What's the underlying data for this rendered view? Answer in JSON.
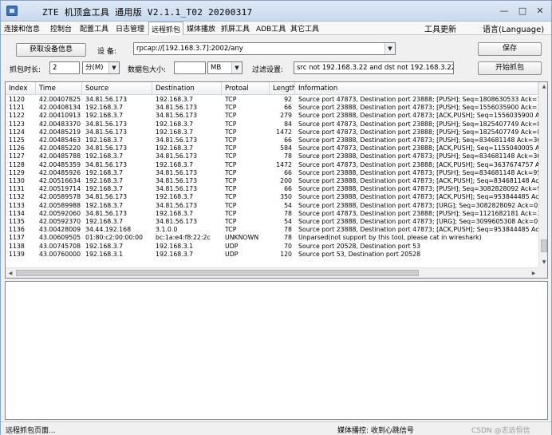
{
  "window": {
    "title": "ZTE 机顶盒工具 通用版 V2.1.1_T02 20200317"
  },
  "menu": {
    "items": [
      "连接和信息",
      "控制台",
      "配置工具",
      "日志管理",
      "远程抓包",
      "媒体播放",
      "抓屏工具",
      "ADB工具",
      "其它工具"
    ],
    "active": "远程抓包",
    "update": "工具更新",
    "language": "语言(Language)"
  },
  "toolbar": {
    "get_device_info": "获取设备信息",
    "device_label": "设    备:",
    "device_value": "rpcap://[192.168.3.7]:2002/any",
    "save": "保存",
    "capture_time_label": "抓包时长:",
    "capture_time_value": "2",
    "capture_time_unit": "分(M)",
    "packet_size_label": "数据包大小:",
    "packet_size_value": "",
    "packet_size_unit": "MB",
    "filter_label": "过滤设置:",
    "filter_value": "src not 192.168.3.22 and dst not 192.168.3.22",
    "start_capture": "开始抓包"
  },
  "table": {
    "columns": [
      "Index",
      "Time",
      "Source",
      "Destination",
      "Protoal",
      "Length",
      "Information"
    ],
    "rows": [
      [
        "1120",
        "42.00407825",
        "34.81.56.173",
        "192.168.3.7",
        "TCP",
        "92",
        "Source port 47873, Destination port 23888; [PUSH]; Seq=1808630533 Ack=1556035"
      ],
      [
        "1121",
        "42.00408134",
        "192.168.3.7",
        "34.81.56.173",
        "TCP",
        "66",
        "Source port 23888, Destination port 47873; [PUSH]; Seq=1556035900 Ack=1825407"
      ],
      [
        "1122",
        "42.00410913",
        "192.168.3.7",
        "34.81.56.173",
        "TCP",
        "279",
        "Source port 23888, Destination port 47873; [ACK,PUSH]; Seq=1556035900 Ack=182"
      ],
      [
        "1123",
        "42.00483370",
        "34.81.56.173",
        "192.168.3.7",
        "TCP",
        "84",
        "Source port 47873, Destination port 23888; [PUSH]; Seq=1825407749 Ack=8346811"
      ],
      [
        "1124",
        "42.00485219",
        "34.81.56.173",
        "192.168.3.7",
        "TCP",
        "1472",
        "Source port 47873, Destination port 23888; [PUSH]; Seq=1825407749 Ack=8346811"
      ],
      [
        "1125",
        "42.00485463",
        "192.168.3.7",
        "34.81.56.173",
        "TCP",
        "66",
        "Source port 23888, Destination port 47873; [PUSH]; Seq=834681148 Ack=36376747"
      ],
      [
        "1126",
        "42.00485220",
        "34.81.56.173",
        "192.168.3.7",
        "TCP",
        "584",
        "Source port 47873, Destination port 23888; [ACK,PUSH]; Seq=1155040005 Ack=834"
      ],
      [
        "1127",
        "42.00485788",
        "192.168.3.7",
        "34.81.56.173",
        "TCP",
        "78",
        "Source port 23888, Destination port 47873; [PUSH]; Seq=834681148 Ack=36376747"
      ],
      [
        "1128",
        "42.00485359",
        "34.81.56.173",
        "192.168.3.7",
        "TCP",
        "1472",
        "Source port 47873, Destination port 23888; [ACK,PUSH]; Seq=3637674757 Ack=834"
      ],
      [
        "1129",
        "42.00485926",
        "192.168.3.7",
        "34.81.56.173",
        "TCP",
        "66",
        "Source port 23888, Destination port 47873; [PUSH]; Seq=834681148 Ack=95384448"
      ],
      [
        "1130",
        "42.00516634",
        "192.168.3.7",
        "34.81.56.173",
        "TCP",
        "200",
        "Source port 23888, Destination port 47873; [ACK,PUSH]; Seq=834681148 Ack=9538"
      ],
      [
        "1131",
        "42.00519714",
        "192.168.3.7",
        "34.81.56.173",
        "TCP",
        "66",
        "Source port 23888, Destination port 47873; [PUSH]; Seq=3082828092 Ack=9538444"
      ],
      [
        "1132",
        "42.00589578",
        "34.81.56.173",
        "192.168.3.7",
        "TCP",
        "350",
        "Source port 23888, Destination port 47873; [ACK,PUSH]; Seq=953844485 Ack=3082"
      ],
      [
        "1133",
        "42.00589988",
        "192.168.3.7",
        "34.81.56.173",
        "TCP",
        "54",
        "Source port 23888, Destination port 47873; [URG]; Seq=3082828092 Ack=0 Win=0 L"
      ],
      [
        "1134",
        "42.00592060",
        "34.81.56.173",
        "192.168.3.7",
        "TCP",
        "78",
        "Source port 47873, Destination port 23888; [PUSH]; Seq=1121682181 Ack=3099605"
      ],
      [
        "1135",
        "42.00592370",
        "192.168.3.7",
        "34.81.56.173",
        "TCP",
        "54",
        "Source port 23888, Destination port 47873; [URG]; Seq=3099605308 Ack=0 Win=0 L"
      ],
      [
        "1136",
        "43.00428009",
        "34.44.192.168",
        "3.1.0.0",
        "TCP",
        "78",
        "Source port 23888, Destination port 47873; [ACK,PUSH]; Seq=953844485 Ack=3082"
      ],
      [
        "1137",
        "43.00609505",
        "01:80:c2:00:00:00",
        "bc:1a:e4:f8:22:2c",
        "UNKNOWN",
        "78",
        "Unparsed(not support by this tool, please cat in wireshark)"
      ],
      [
        "1138",
        "43.00745708",
        "192.168.3.7",
        "192.168.3.1",
        "UDP",
        "70",
        "Source port 20528, Destination port 53"
      ],
      [
        "1139",
        "43.00760000",
        "192.168.3.1",
        "192.168.3.7",
        "UDP",
        "120",
        "Source port 53, Destination port 20528"
      ]
    ]
  },
  "status": {
    "left": "远程抓包页面...",
    "right": "媒体播控: 收到心跳信号",
    "watermark": "CSDN @志远恒信"
  },
  "colors": {
    "accent": "#3f74b8",
    "window_border": "#8aa5c8"
  }
}
